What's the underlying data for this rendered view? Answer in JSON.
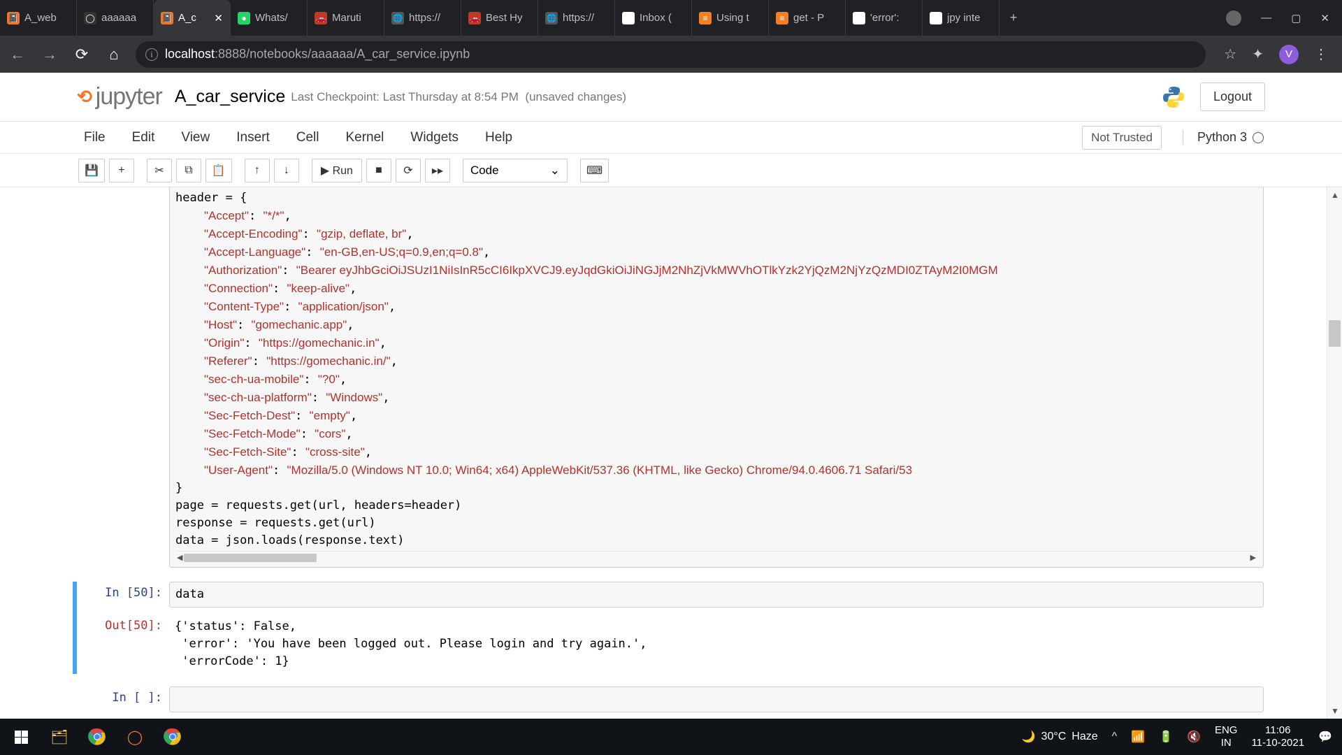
{
  "browser": {
    "tabs": [
      {
        "title": "A_web",
        "favicon": "📓",
        "fav_bg": "#f37626"
      },
      {
        "title": "aaaaaa",
        "favicon": "◯",
        "fav_bg": "#333"
      },
      {
        "title": "A_c",
        "favicon": "📓",
        "fav_bg": "#f37626",
        "active": true,
        "close": "✕"
      },
      {
        "title": "Whats/",
        "favicon": "●",
        "fav_bg": "#25d366"
      },
      {
        "title": "Maruti",
        "favicon": "🚗",
        "fav_bg": "#c0392b"
      },
      {
        "title": "https://",
        "favicon": "🌐",
        "fav_bg": "#555"
      },
      {
        "title": "Best Hy",
        "favicon": "🚗",
        "fav_bg": "#c0392b"
      },
      {
        "title": "https://",
        "favicon": "🌐",
        "fav_bg": "#555"
      },
      {
        "title": "Inbox (",
        "favicon": "M",
        "fav_bg": "#fff"
      },
      {
        "title": "Using t",
        "favicon": "≡",
        "fav_bg": "#f48024"
      },
      {
        "title": "get - P",
        "favicon": "≡",
        "fav_bg": "#f48024"
      },
      {
        "title": "'error':",
        "favicon": "G",
        "fav_bg": "#fff"
      },
      {
        "title": "jpy inte",
        "favicon": "G",
        "fav_bg": "#fff"
      }
    ],
    "url_host": "localhost",
    "url_port": ":8888",
    "url_path": "/notebooks/aaaaaa/A_car_service.ipynb",
    "avatar_letter": "V"
  },
  "jupyter": {
    "logo_text": "jupyter",
    "notebook_name": "A_car_service",
    "checkpoint": "Last Checkpoint: Last Thursday at 8:54 PM",
    "unsaved": "(unsaved changes)",
    "logout": "Logout",
    "menu": [
      "File",
      "Edit",
      "View",
      "Insert",
      "Cell",
      "Kernel",
      "Widgets",
      "Help"
    ],
    "not_trusted": "Not Trusted",
    "kernel": "Python 3",
    "toolbar": {
      "save": "💾",
      "add": "+",
      "cut": "✂",
      "copy": "⧉",
      "paste": "📋",
      "up": "↑",
      "down": "↓",
      "run": "▶ Run",
      "stop": "■",
      "restart": "⟳",
      "ff": "▸▸",
      "celltype": "Code",
      "cmd": "⌨"
    },
    "cells": {
      "code0_lines": [
        {
          "plain": "header = {"
        },
        {
          "key": "\"Accept\"",
          "sep": ": ",
          "val": "\"*/*\"",
          "tail": ","
        },
        {
          "key": "\"Accept-Encoding\"",
          "sep": ": ",
          "val": "\"gzip, deflate, br\"",
          "tail": ","
        },
        {
          "key": "\"Accept-Language\"",
          "sep": ": ",
          "val": "\"en-GB,en-US;q=0.9,en;q=0.8\"",
          "tail": ","
        },
        {
          "key": "\"Authorization\"",
          "sep": ": ",
          "val": "\"Bearer eyJhbGciOiJSUzI1NiIsInR5cCI6IkpXVCJ9.eyJqdGkiOiJiNGJjM2NhZjVkMWVhOTlkYzk2YjQzM2NjYzQzMDI0ZTAyM2I0MGM",
          "tail": ""
        },
        {
          "key": "\"Connection\"",
          "sep": ": ",
          "val": "\"keep-alive\"",
          "tail": ","
        },
        {
          "key": "\"Content-Type\"",
          "sep": ": ",
          "val": "\"application/json\"",
          "tail": ","
        },
        {
          "key": "\"Host\"",
          "sep": ": ",
          "val": "\"gomechanic.app\"",
          "tail": ","
        },
        {
          "key": "\"Origin\"",
          "sep": ": ",
          "val": "\"https://gomechanic.in\"",
          "tail": ","
        },
        {
          "key": "\"Referer\"",
          "sep": ": ",
          "val": "\"https://gomechanic.in/\"",
          "tail": ","
        },
        {
          "key": "\"sec-ch-ua-mobile\"",
          "sep": ": ",
          "val": "\"?0\"",
          "tail": ","
        },
        {
          "key": "\"sec-ch-ua-platform\"",
          "sep": ": ",
          "val": "\"Windows\"",
          "tail": ","
        },
        {
          "key": "\"Sec-Fetch-Dest\"",
          "sep": ": ",
          "val": "\"empty\"",
          "tail": ","
        },
        {
          "key": "\"Sec-Fetch-Mode\"",
          "sep": ": ",
          "val": "\"cors\"",
          "tail": ","
        },
        {
          "key": "\"Sec-Fetch-Site\"",
          "sep": ": ",
          "val": "\"cross-site\"",
          "tail": ","
        },
        {
          "key": "\"User-Agent\"",
          "sep": ": ",
          "val": "\"Mozilla/5.0 (Windows NT 10.0; Win64; x64) AppleWebKit/537.36 (KHTML, like Gecko) Chrome/94.0.4606.71 Safari/53",
          "tail": ""
        },
        {
          "plain": "}"
        },
        {
          "plain": "page = requests.get(url, headers=header)"
        },
        {
          "plain": "response = requests.get(url)"
        },
        {
          "plain": "data = json.loads(response.text)"
        }
      ],
      "in50_prompt": "In [50]:",
      "in50_code": "data",
      "out50_prompt": "Out[50]:",
      "out50_text": "{'status': False,\n 'error': 'You have been logged out. Please login and try again.',\n 'errorCode': 1}",
      "empty_prompt": "In [ ]:"
    }
  },
  "taskbar": {
    "weather_temp": "30°C",
    "weather_cond": "Haze",
    "lang1": "ENG",
    "lang2": "IN",
    "time": "11:06",
    "date": "11-10-2021"
  }
}
